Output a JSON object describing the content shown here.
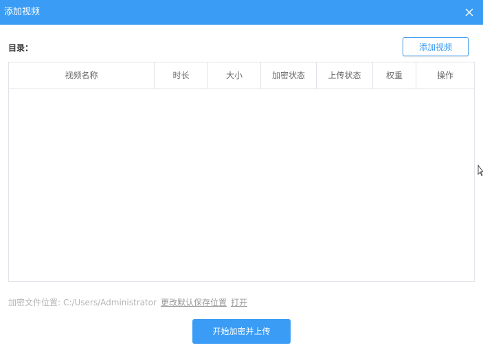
{
  "dialog": {
    "title": "添加视频",
    "close_icon": "close-icon"
  },
  "toolbar": {
    "directory_label": "目录：",
    "add_video_label": "添加视频"
  },
  "table": {
    "columns": [
      "视频名称",
      "时长",
      "大小",
      "加密状态",
      "上传状态",
      "权重",
      "操作"
    ],
    "rows": []
  },
  "footer": {
    "path_label": "加密文件位置:",
    "path_value": "C:/Users/Administrator",
    "change_link": "更改默认保存位置",
    "open_link": "打开"
  },
  "primary_action": {
    "label": "开始加密并上传"
  },
  "colors": {
    "accent": "#3b9cf5",
    "border": "#dfe3e8",
    "muted_text": "#b4b4b4"
  }
}
